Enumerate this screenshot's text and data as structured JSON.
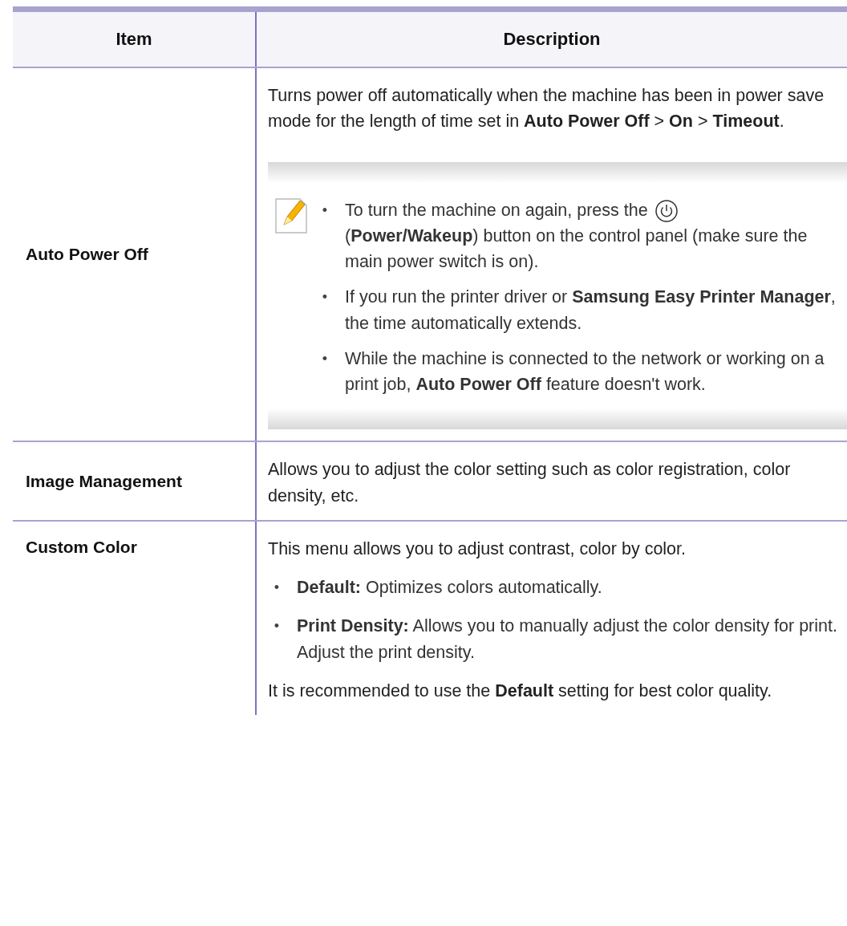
{
  "table": {
    "columns": [
      "Item",
      "Description"
    ],
    "rows": [
      {
        "item": "Auto Power Off",
        "description": [
          {
            "kind": "paragraph",
            "text": "Turns power off automatically when the machine has been in power save mode for the length of time set in **Auto Power Off** > **On** > **Timeout**."
          },
          {
            "kind": "note",
            "items": [
              {
                "marker": "•",
                "text": "To turn the machine on again, press the",
                "text_after_icon": "(**Power/Wakeup**) button on the control panel (make sure the main power switch is on)."
              },
              {
                "marker": "•",
                "text": " If you run the printer driver or **Samsung Easy Printer Manager**, the time automatically extends."
              },
              {
                "marker": "•",
                "text": "While the machine is connected to the network or working on a print job, **Auto Power Off** feature doesn't work."
              }
            ]
          }
        ]
      },
      {
        "item": "Image Management",
        "description": [
          {
            "kind": "paragraph",
            "text": "Allows you to adjust the color setting such as color registration, color density, etc."
          }
        ]
      },
      {
        "item": "Custom Color",
        "description": [
          {
            "kind": "paragraph",
            "text": "This menu allows you to adjust contrast, color by color."
          },
          {
            "kind": "bullet",
            "marker": "•",
            "text": "**Default:** Optimizes colors automatically."
          },
          {
            "kind": "bullet",
            "marker": "•",
            "text": "**Print Density:** Allows you to manually adjust the color density for print. Adjust the print density."
          },
          {
            "kind": "paragraph",
            "text": "It is recommended to use the **Default** setting for best color quality."
          }
        ]
      }
    ]
  }
}
